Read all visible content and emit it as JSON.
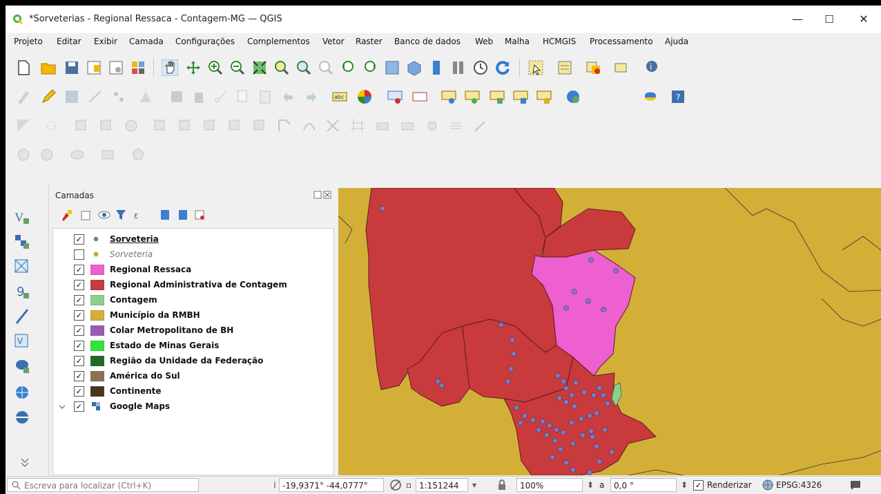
{
  "window": {
    "title": "*Sorveterias - Regional Ressaca - Contagem-MG — QGIS",
    "minimize": "—",
    "maximize": "☐",
    "close": "✕"
  },
  "menu": [
    "Projeto",
    "Editar",
    "Exibir",
    "Camada",
    "Configurações",
    "Complementos",
    "Vetor",
    "Raster",
    "Banco de dados",
    "Web",
    "Malha",
    "HCMGIS",
    "Processamento",
    "Ajuda"
  ],
  "layers_panel": {
    "title": "Camadas",
    "layers": [
      {
        "name": "Sorveteria",
        "checked": true,
        "symbol": "point",
        "color": "#7d7bbf",
        "italic": false,
        "underline": true
      },
      {
        "name": "Sorveteria",
        "checked": false,
        "symbol": "point",
        "color": "#e8a820",
        "italic": true,
        "underline": false
      },
      {
        "name": "Regional Ressaca",
        "checked": true,
        "symbol": "fill",
        "color": "#ee5fd0"
      },
      {
        "name": "Regional Administrativa de Contagem",
        "checked": true,
        "symbol": "fill",
        "color": "#c93a3c"
      },
      {
        "name": "Contagem",
        "checked": true,
        "symbol": "fill",
        "color": "#8ecf8e"
      },
      {
        "name": "Município da RMBH",
        "checked": true,
        "symbol": "fill",
        "color": "#d3af38"
      },
      {
        "name": "Colar Metropolitano de BH",
        "checked": true,
        "symbol": "fill",
        "color": "#9a5ab5"
      },
      {
        "name": "Estado de Minas Gerais",
        "checked": true,
        "symbol": "fill",
        "color": "#2ee63a"
      },
      {
        "name": "Região da Unidade da Federação",
        "checked": true,
        "symbol": "fill",
        "color": "#1f6b24"
      },
      {
        "name": "América do Sul",
        "checked": true,
        "symbol": "fill",
        "color": "#8b7355"
      },
      {
        "name": "Continente",
        "checked": true,
        "symbol": "fill",
        "color": "#4a3520"
      },
      {
        "name": "Google Maps",
        "checked": true,
        "symbol": "raster",
        "color": "#3a6fb0"
      }
    ]
  },
  "statusbar": {
    "search_placeholder": "Escreva para localizar (Ctrl+K)",
    "coordinate": "-19,9371° -44,0777°",
    "scale": "1:151244",
    "magnifier": "100%",
    "rotation_label": "a",
    "rotation": "0,0 °",
    "render_label": "Renderizar",
    "crs": "EPSG:4326"
  },
  "colors": {
    "regional_ressaca": "#ee5fd0",
    "regional_contagem": "#c93a3c",
    "rmbh": "#d3af38",
    "sorveteria_point": "#7d7bbf"
  }
}
